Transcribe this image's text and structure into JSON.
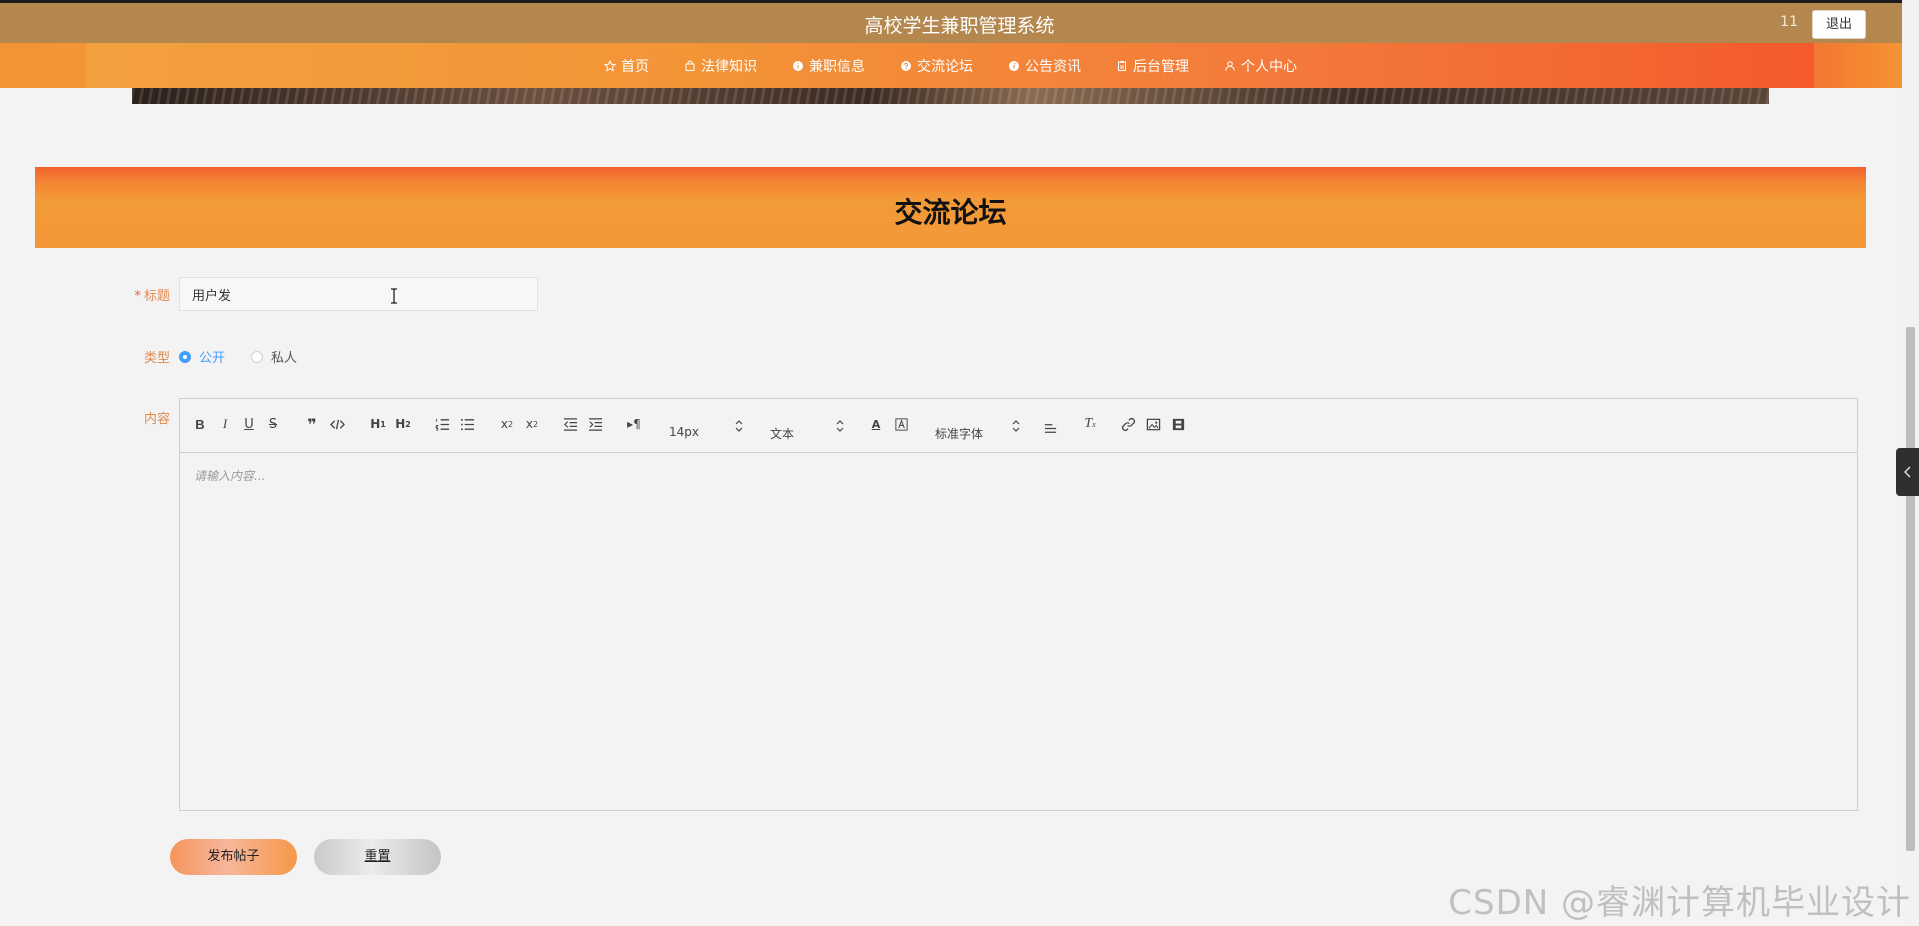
{
  "header": {
    "site_title": "高校学生兼职管理系统",
    "user_name": "11",
    "logout_label": "退出"
  },
  "nav": {
    "items": [
      {
        "label": "首页",
        "icon": "star-icon"
      },
      {
        "label": "法律知识",
        "icon": "bag-icon"
      },
      {
        "label": "兼职信息",
        "icon": "info-icon"
      },
      {
        "label": "交流论坛",
        "icon": "question-icon"
      },
      {
        "label": "公告资讯",
        "icon": "info-italic-icon"
      },
      {
        "label": "后台管理",
        "icon": "clipboard-icon"
      },
      {
        "label": "个人中心",
        "icon": "user-icon"
      }
    ]
  },
  "section": {
    "title": "交流论坛"
  },
  "form": {
    "title_label": "标题",
    "required_mark": "*",
    "title_value": "用户发",
    "type_label": "类型",
    "type_options": [
      "公开",
      "私人"
    ],
    "type_selected": "公开",
    "content_label": "内容"
  },
  "editor": {
    "font_size": "14px",
    "paragraph_style": "文本",
    "font_family": "标准字体",
    "placeholder": "请输入内容..."
  },
  "buttons": {
    "submit_label": "发布帖子",
    "reset_label": "重置"
  },
  "watermark": "CSDN @睿渊计算机毕业设计",
  "colors": {
    "topbar": "#b3874d",
    "nav_gradient_start": "#f3a040",
    "nav_gradient_end": "#f35a2c",
    "header_band": "#f39838",
    "label": "#e08a4c",
    "radio_active": "#409eff"
  }
}
